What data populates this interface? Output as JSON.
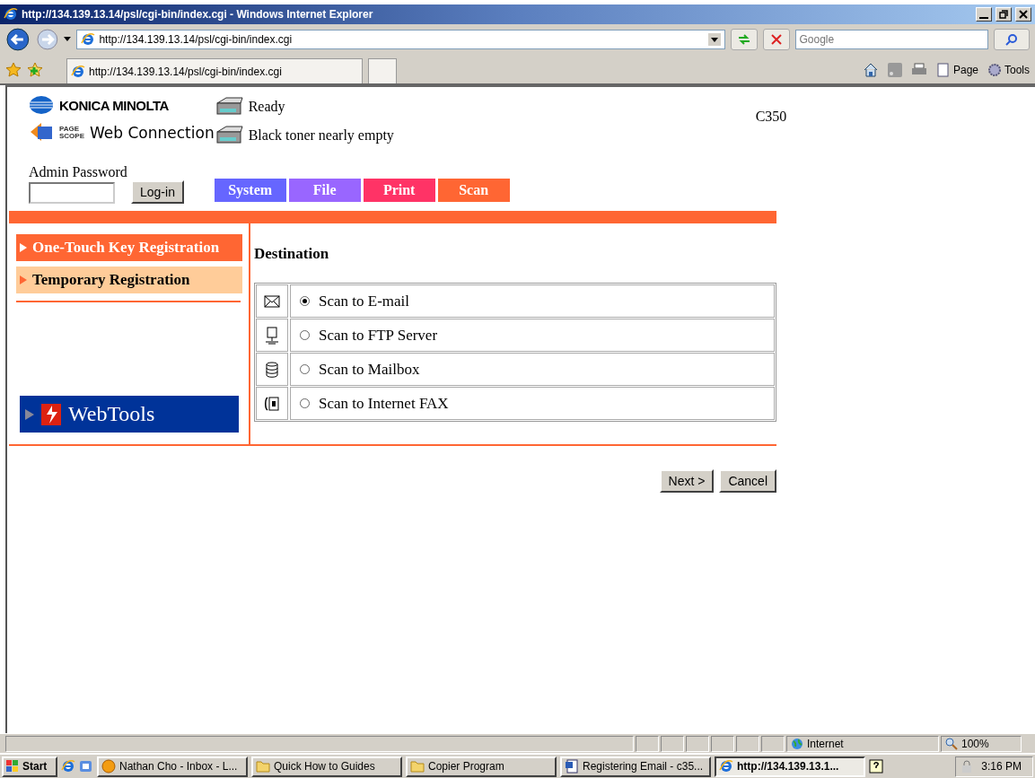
{
  "browser": {
    "title": "http://134.139.13.14/psl/cgi-bin/index.cgi - Windows Internet Explorer",
    "address": "http://134.139.13.14/psl/cgi-bin/index.cgi",
    "search": {
      "placeholder": "Google"
    },
    "tab": "http://134.139.13.14/psl/cgi-bin/index.cgi",
    "commands": [
      "Page",
      "Tools"
    ]
  },
  "header": {
    "brand": "KONICA MINOLTA",
    "product_small": "PAGE SCOPE",
    "product": "Web Connection",
    "status": [
      "Ready",
      "Black toner nearly empty"
    ],
    "model": "C350"
  },
  "login": {
    "label": "Admin Password",
    "button": "Log-in"
  },
  "tabs": [
    {
      "label": "System",
      "color": "#6666ff"
    },
    {
      "label": "File",
      "color": "#9966ff"
    },
    {
      "label": "Print",
      "color": "#ff3366"
    },
    {
      "label": "Scan",
      "color": "#ff6633"
    }
  ],
  "menu": [
    {
      "label": "One-Touch Key Registration",
      "selected": true
    },
    {
      "label": "Temporary Registration",
      "selected": false
    }
  ],
  "webtools": "WebTools",
  "destination": {
    "heading": "Destination",
    "options": [
      {
        "kind": "email",
        "label": "Scan to E-mail",
        "selected": true
      },
      {
        "kind": "ftp",
        "label": "Scan to FTP Server",
        "selected": false
      },
      {
        "kind": "mailbox",
        "label": "Scan to Mailbox",
        "selected": false
      },
      {
        "kind": "fax",
        "label": "Scan to Internet FAX",
        "selected": false
      }
    ]
  },
  "buttons": [
    "Next >",
    "Cancel"
  ],
  "status_bar": {
    "zone": "Internet",
    "zoom": "100%"
  },
  "taskbar": {
    "start": "Start",
    "tasks": [
      {
        "kind": "mail",
        "label": "Nathan Cho - Inbox - L...",
        "active": false
      },
      {
        "kind": "folder",
        "label": "Quick How to Guides",
        "active": false
      },
      {
        "kind": "folder",
        "label": "Copier Program",
        "active": false
      },
      {
        "kind": "word",
        "label": "Registering Email - c35...",
        "active": false
      },
      {
        "kind": "ie",
        "label": "http://134.139.13.1...",
        "active": true
      }
    ],
    "time": "3:16 PM"
  }
}
